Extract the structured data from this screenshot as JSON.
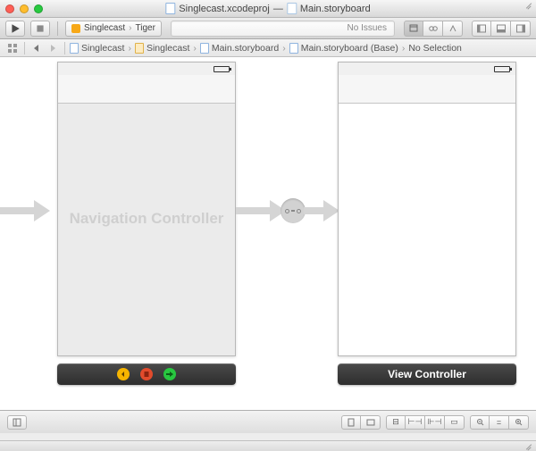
{
  "titlebar": {
    "project_file": "Singlecast.xcodeproj",
    "separator": "—",
    "current_file": "Main.storyboard"
  },
  "toolbar": {
    "scheme_name": "Singlecast",
    "destination": "Tiger",
    "status_text": "No Issues"
  },
  "jumpbar": {
    "crumbs": [
      "Singlecast",
      "Singlecast",
      "Main.storyboard",
      "Main.storyboard (Base)",
      "No Selection"
    ]
  },
  "canvas": {
    "nav_controller_label": "Navigation Controller",
    "view_controller_label": "View Controller"
  },
  "icons": {
    "back_chevron": "‹",
    "fwd_chevron": "›"
  }
}
